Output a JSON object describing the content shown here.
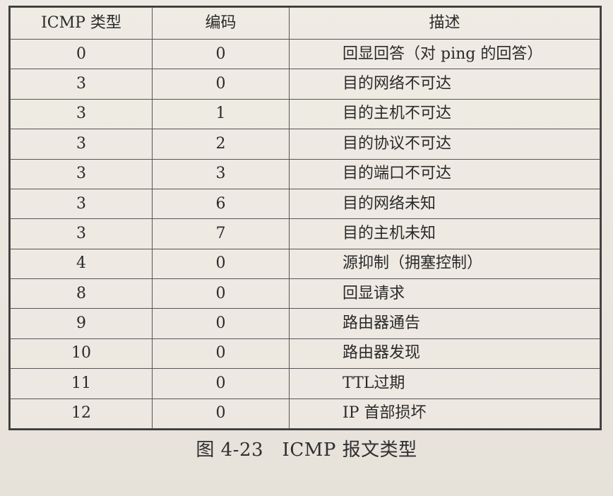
{
  "table": {
    "headers": [
      "ICMP 类型",
      "编码",
      "描述"
    ],
    "rows": [
      [
        "0",
        "0",
        "回显回答（对 ping 的回答）"
      ],
      [
        "3",
        "0",
        "目的网络不可达"
      ],
      [
        "3",
        "1",
        "目的主机不可达"
      ],
      [
        "3",
        "2",
        "目的协议不可达"
      ],
      [
        "3",
        "3",
        "目的端口不可达"
      ],
      [
        "3",
        "6",
        "目的网络未知"
      ],
      [
        "3",
        "7",
        "目的主机未知"
      ],
      [
        "4",
        "0",
        "源抑制（拥塞控制）"
      ],
      [
        "8",
        "0",
        "回显请求"
      ],
      [
        "9",
        "0",
        "路由器通告"
      ],
      [
        "10",
        "0",
        "路由器发现"
      ],
      [
        "11",
        "0",
        "TTL过期"
      ],
      [
        "12",
        "0",
        "IP 首部损坏"
      ]
    ]
  },
  "caption": "图 4-23　ICMP 报文类型"
}
